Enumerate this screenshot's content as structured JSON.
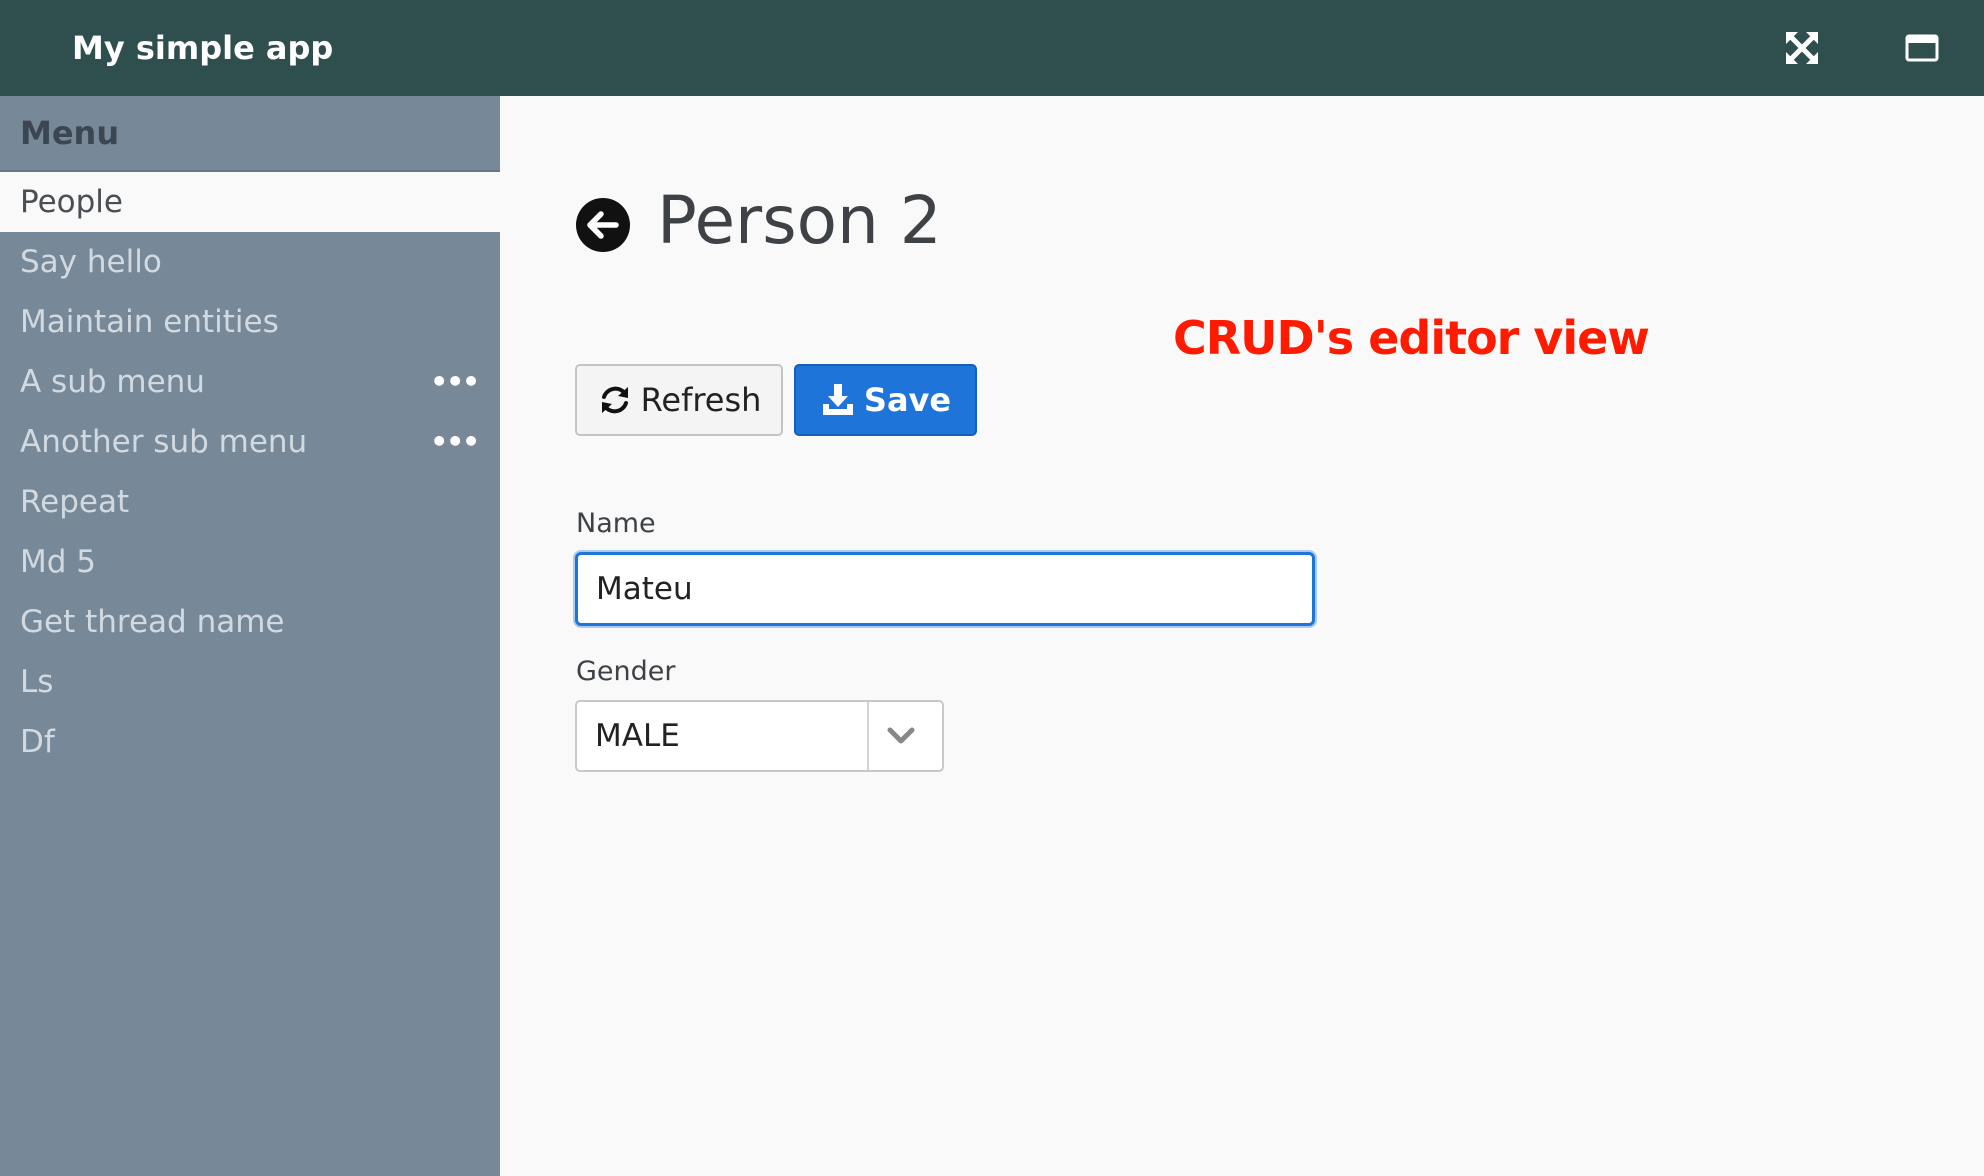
{
  "header": {
    "app_title": "My simple app",
    "icons": [
      "expand-icon",
      "window-icon"
    ],
    "background_color": "#2f4f4f"
  },
  "sidebar": {
    "title": "Menu",
    "background_color": "#778899",
    "items": [
      {
        "label": "People",
        "active": true,
        "has_more": false
      },
      {
        "label": "Say hello",
        "active": false,
        "has_more": false
      },
      {
        "label": "Maintain entities",
        "active": false,
        "has_more": false
      },
      {
        "label": "A sub menu",
        "active": false,
        "has_more": true
      },
      {
        "label": "Another sub menu",
        "active": false,
        "has_more": true
      },
      {
        "label": "Repeat",
        "active": false,
        "has_more": false
      },
      {
        "label": "Md 5",
        "active": false,
        "has_more": false
      },
      {
        "label": "Get thread name",
        "active": false,
        "has_more": false
      },
      {
        "label": "Ls",
        "active": false,
        "has_more": false
      },
      {
        "label": "Df",
        "active": false,
        "has_more": false
      }
    ],
    "more_glyph": "•••"
  },
  "main": {
    "page_title": "Person 2",
    "annotation": "CRUD's editor view",
    "toolbar": {
      "refresh_label": "Refresh",
      "save_label": "Save",
      "save_color": "#1e74d8"
    },
    "form": {
      "name_label": "Name",
      "name_value": "Mateu",
      "gender_label": "Gender",
      "gender_value": "MALE"
    }
  }
}
